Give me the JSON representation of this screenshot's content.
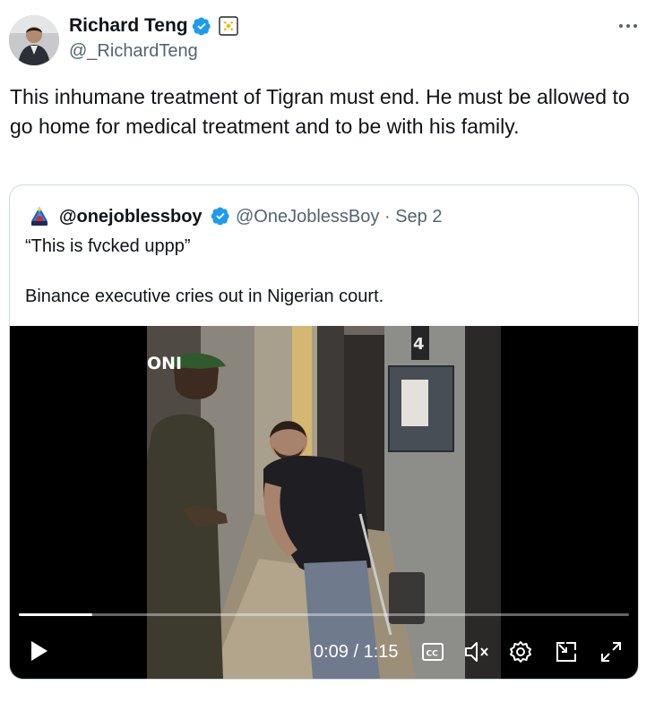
{
  "author": {
    "name": "Richard Teng",
    "handle": "@_RichardTeng",
    "verified": true,
    "affiliate_badge": "binance-icon"
  },
  "tweet": {
    "text": "This inhumane treatment of Tigran must end. He must be allowed to go home for medical treatment and to be with his family."
  },
  "quoted": {
    "name": "@onejoblessboy",
    "handle": "@OneJoblessBoy",
    "separator": "·",
    "date": "Sep 2",
    "verified": true,
    "text_line1": "“This is fvcked uppp”",
    "text_line2": "Binance executive cries out in Nigerian court.",
    "video": {
      "watermark": "ONI",
      "current_time": "0:09",
      "duration": "1:15",
      "time_display": "0:09 / 1:15",
      "progress_fraction": 0.12
    }
  },
  "colors": {
    "verified_blue": "#1d9bf0",
    "binance_yellow": "#f0b90b",
    "secondary_text": "#536471",
    "border": "#cfd9de"
  },
  "icons": [
    "more-icon",
    "play-icon",
    "captions-icon",
    "mute-icon",
    "settings-icon",
    "pip-icon",
    "fullscreen-icon"
  ]
}
